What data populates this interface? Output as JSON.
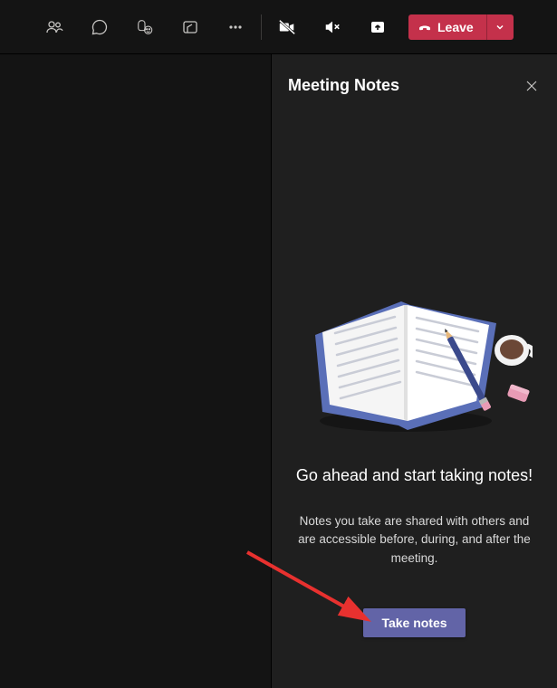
{
  "topbar": {
    "leave_label": "Leave"
  },
  "panel": {
    "title": "Meeting Notes",
    "heading": "Go ahead and start taking notes!",
    "subtext": "Notes you take are shared with others and are accessible before, during, and after the meeting.",
    "button_label": "Take notes"
  }
}
